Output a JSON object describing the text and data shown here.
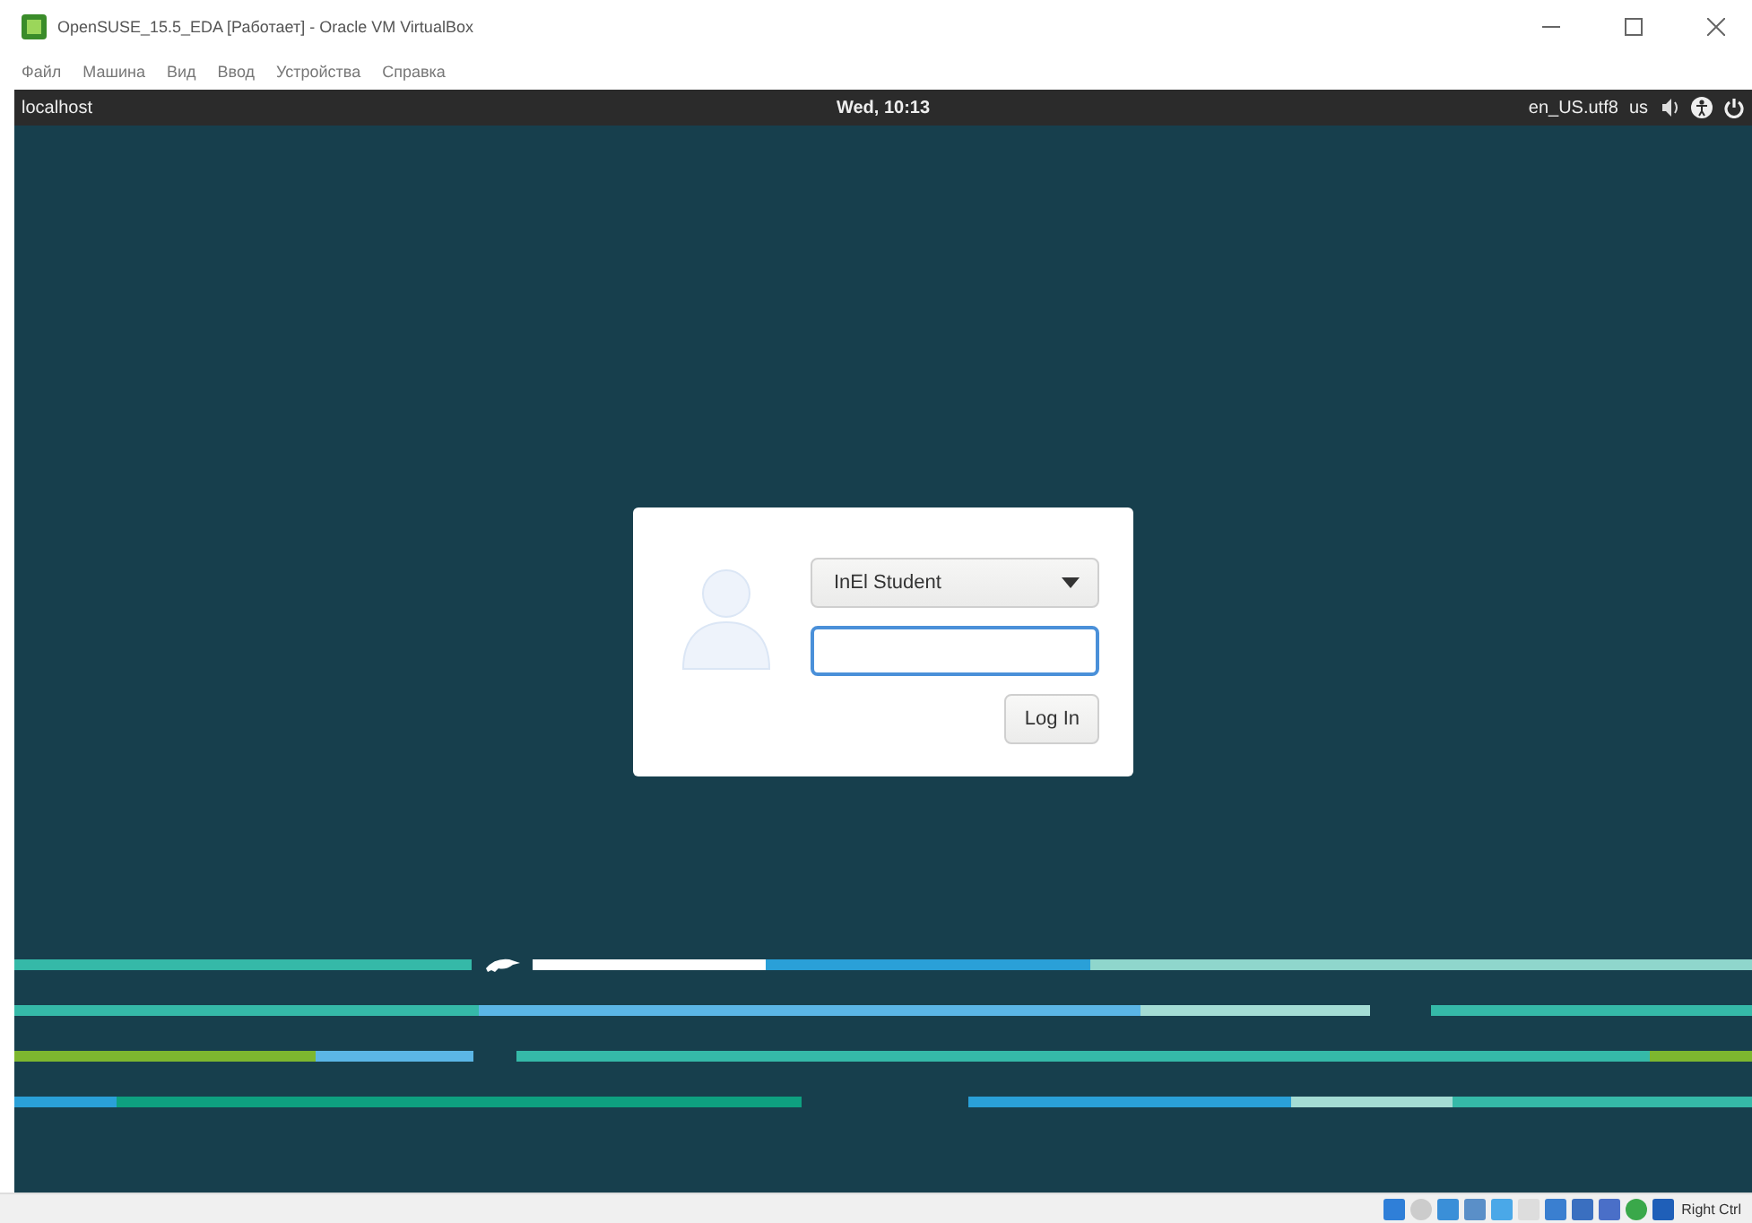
{
  "window": {
    "title": "OpenSUSE_15.5_EDA [Работает] - Oracle VM VirtualBox"
  },
  "menu": [
    "Файл",
    "Машина",
    "Вид",
    "Ввод",
    "Устройства",
    "Справка"
  ],
  "top_bar": {
    "host": "localhost",
    "clock": "Wed, 10:13",
    "locale": "en_US.utf8",
    "keyboard": "us"
  },
  "login": {
    "user": "InEl Student",
    "password_field": {
      "focused": true
    },
    "button": "Log In"
  },
  "status_bar": {
    "host_key": "Right Ctrl"
  }
}
